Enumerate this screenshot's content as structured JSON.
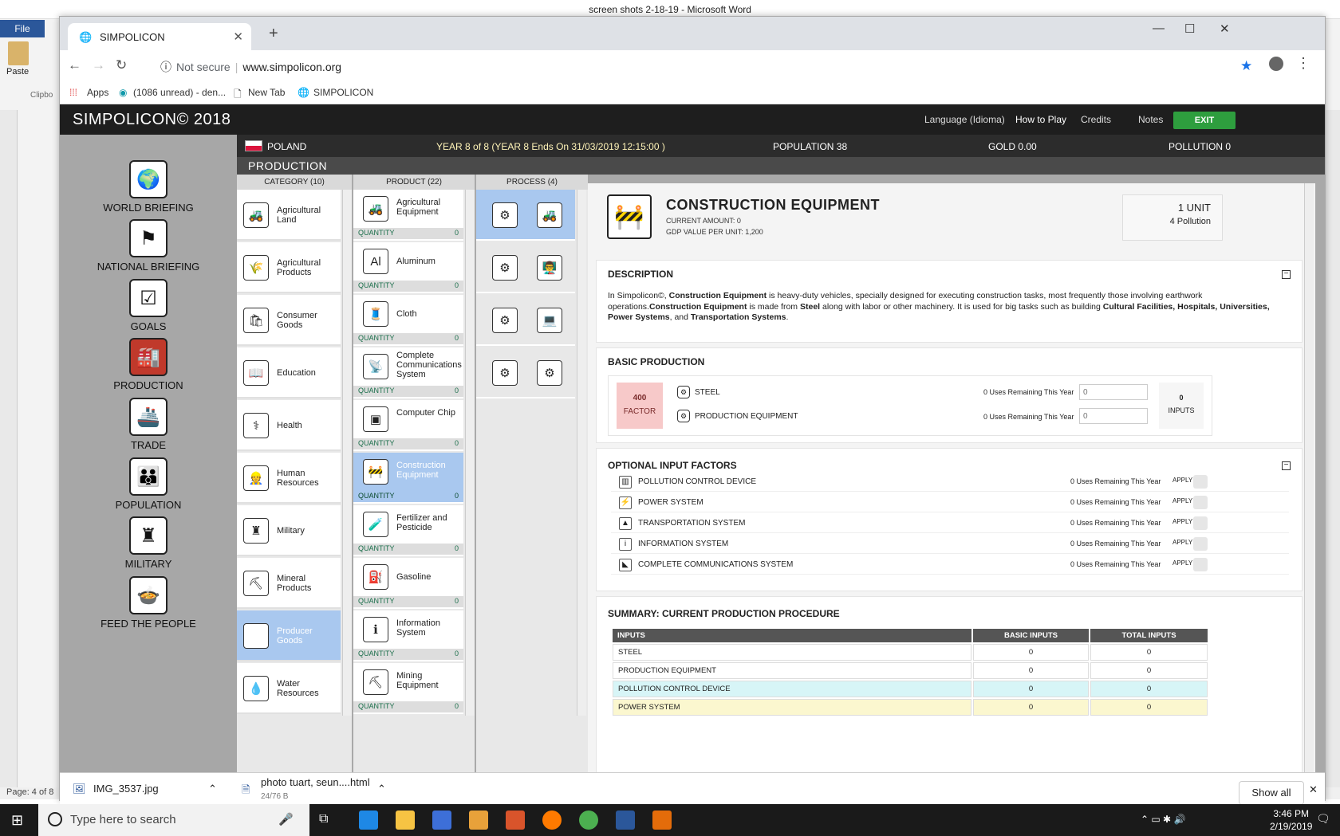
{
  "word": {
    "title": "screen shots 2-18-19  -  Microsoft Word",
    "file_label": "File",
    "paste_label": "Paste",
    "clipboard_label": "Clipbo",
    "page_status": "Page: 4 of 8"
  },
  "browser": {
    "tab_title": "SIMPOLICON",
    "new_tab": "+",
    "not_secure": "Not secure",
    "url": "www.simpolicon.org",
    "bookmarks": [
      "Apps",
      "(1086 unread) - den...",
      "New Tab",
      "SIMPOLICON"
    ]
  },
  "game": {
    "brand": "SIMPOLICON© 2018",
    "menu": [
      "Language (Idioma)",
      "How to Play",
      "Credits",
      "Notes"
    ],
    "exit": "EXIT",
    "country": "POLAND",
    "year": "YEAR  8 of 8  (YEAR 8 Ends On 31/03/2019 12:15:00 )",
    "population": "POPULATION  38",
    "gold": "GOLD  0.00",
    "pollution": "POLLUTION  0",
    "section": "PRODUCTION",
    "nav": [
      {
        "label": "WORLD BRIEFING",
        "icon": "🌍"
      },
      {
        "label": "NATIONAL BRIEFING",
        "icon": "⚑"
      },
      {
        "label": "GOALS",
        "icon": "☑"
      },
      {
        "label": "PRODUCTION",
        "icon": "🏭"
      },
      {
        "label": "TRADE",
        "icon": "🚢"
      },
      {
        "label": "POPULATION",
        "icon": "👪"
      },
      {
        "label": "MILITARY",
        "icon": "♜"
      },
      {
        "label": "FEED THE PEOPLE",
        "icon": "🍲"
      }
    ],
    "col_headers": {
      "category": "CATEGORY (10)",
      "product": "PRODUCT (22)",
      "process": "PROCESS (4)"
    },
    "categories": [
      {
        "label": "Agricultural Land",
        "icon": "🚜"
      },
      {
        "label": "Agricultural Products",
        "icon": "🌾"
      },
      {
        "label": "Consumer Goods",
        "icon": "🛍"
      },
      {
        "label": "Education",
        "icon": "📖"
      },
      {
        "label": "Health",
        "icon": "⚕"
      },
      {
        "label": "Human Resources",
        "icon": "👷"
      },
      {
        "label": "Military",
        "icon": "♜"
      },
      {
        "label": "Mineral Products",
        "icon": "⛏"
      },
      {
        "label": "Producer Goods",
        "icon": "⚙"
      },
      {
        "label": "Water Resources",
        "icon": "💧"
      }
    ],
    "quantity_label": "QUANTITY",
    "products": [
      {
        "label": "Agricultural Equipment",
        "icon": "🚜",
        "qty": "0"
      },
      {
        "label": "Aluminum",
        "icon": "Al",
        "qty": "0"
      },
      {
        "label": "Cloth",
        "icon": "🧵",
        "qty": "0"
      },
      {
        "label": "Complete Communications System",
        "icon": "📡",
        "qty": "0"
      },
      {
        "label": "Computer Chip",
        "icon": "▣",
        "qty": "0"
      },
      {
        "label": "Construction Equipment",
        "icon": "🚧",
        "qty": "0"
      },
      {
        "label": "Fertilizer and Pesticide",
        "icon": "🧪",
        "qty": "0"
      },
      {
        "label": "Gasoline",
        "icon": "⛽",
        "qty": "0"
      },
      {
        "label": "Information System",
        "icon": "ℹ",
        "qty": "0"
      },
      {
        "label": "Mining Equipment",
        "icon": "⛏",
        "qty": "0"
      }
    ],
    "processes": [
      {
        "a": "⚙",
        "b": "🚜"
      },
      {
        "a": "⚙",
        "b": "👨‍🏫"
      },
      {
        "a": "⚙",
        "b": "💻"
      },
      {
        "a": "⚙",
        "b": "⚙"
      }
    ],
    "detail": {
      "title": "CONSTRUCTION EQUIPMENT",
      "current_amount": "CURRENT AMOUNT: 0",
      "gdp": "GDP VALUE PER UNIT: 1,200",
      "unit": "1 UNIT",
      "unit_pollution": "4 Pollution",
      "desc_heading": "DESCRIPTION",
      "basic_heading": "BASIC PRODUCTION",
      "factor_value": "400",
      "factor_label": "FACTOR",
      "basic_inputs": [
        {
          "name": "STEEL",
          "uses": "0 Uses Remaining This Year",
          "placeholder": "0"
        },
        {
          "name": "PRODUCTION EQUIPMENT",
          "uses": "0 Uses Remaining This Year",
          "placeholder": "0"
        }
      ],
      "inputs_count": "0",
      "inputs_label": "INPUTS",
      "optional_heading": "OPTIONAL INPUT FACTORS",
      "apply_label": "APPLY",
      "optional": [
        {
          "name": "POLLUTION CONTROL DEVICE",
          "uses": "0 Uses Remaining This Year"
        },
        {
          "name": "POWER SYSTEM",
          "uses": "0 Uses Remaining This Year"
        },
        {
          "name": "TRANSPORTATION SYSTEM",
          "uses": "0 Uses Remaining This Year"
        },
        {
          "name": "INFORMATION SYSTEM",
          "uses": "0 Uses Remaining This Year"
        },
        {
          "name": "COMPLETE COMMUNICATIONS SYSTEM",
          "uses": "0 Uses Remaining This Year"
        }
      ],
      "summary_heading": "SUMMARY: CURRENT PRODUCTION PROCEDURE",
      "summary_cols": [
        "INPUTS",
        "BASIC INPUTS",
        "TOTAL INPUTS"
      ],
      "summary_rows": [
        [
          "STEEL",
          "0",
          "0"
        ],
        [
          "PRODUCTION EQUIPMENT",
          "0",
          "0"
        ],
        [
          "POLLUTION CONTROL DEVICE",
          "0",
          "0"
        ],
        [
          "POWER SYSTEM",
          "0",
          "0"
        ]
      ]
    }
  },
  "downloads": {
    "file1": "IMG_3537.jpg",
    "file2": "photo tuart, seun....html",
    "file2_size": "24/76 B",
    "show_all": "Show all"
  },
  "taskbar": {
    "search": "Type here to search",
    "time": "3:46 PM",
    "date": "2/19/2019"
  }
}
